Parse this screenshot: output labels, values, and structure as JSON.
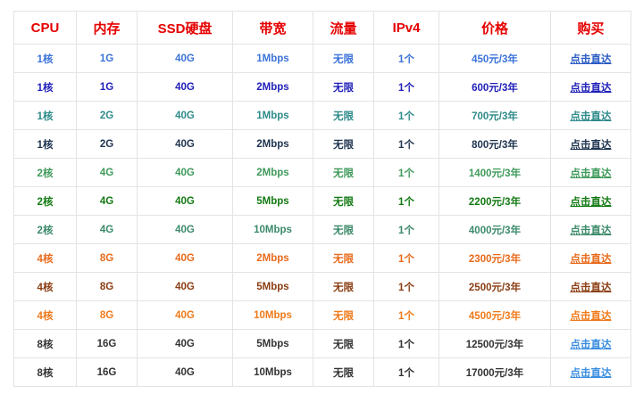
{
  "table": {
    "headers": [
      "CPU",
      "内存",
      "SSD硬盘",
      "带宽",
      "流量",
      "IPv4",
      "价格",
      "购买"
    ],
    "rows": [
      {
        "cpu": "1核",
        "memory": "1G",
        "ssd": "40G",
        "bandwidth": "1Mbps",
        "traffic": "无限",
        "ipv4": "1个",
        "price": "450元/3年",
        "buy_label": "点击直达",
        "color": "#3b73d9",
        "link_color": "#2a5bc4"
      },
      {
        "cpu": "1核",
        "memory": "1G",
        "ssd": "40G",
        "bandwidth": "2Mbps",
        "traffic": "无限",
        "ipv4": "1个",
        "price": "600元/3年",
        "buy_label": "点击直达",
        "color": "#1f1fb8",
        "link_color": "#1f1fb8"
      },
      {
        "cpu": "1核",
        "memory": "2G",
        "ssd": "40G",
        "bandwidth": "1Mbps",
        "traffic": "无限",
        "ipv4": "1个",
        "price": "700元/3年",
        "buy_label": "点击直达",
        "color": "#2e8a8a",
        "link_color": "#2e8a8a"
      },
      {
        "cpu": "1核",
        "memory": "2G",
        "ssd": "40G",
        "bandwidth": "2Mbps",
        "traffic": "无限",
        "ipv4": "1个",
        "price": "800元/3年",
        "buy_label": "点击直达",
        "color": "#1e3350",
        "link_color": "#1e3350"
      },
      {
        "cpu": "2核",
        "memory": "4G",
        "ssd": "40G",
        "bandwidth": "2Mbps",
        "traffic": "无限",
        "ipv4": "1个",
        "price": "1400元/3年",
        "buy_label": "点击直达",
        "color": "#3f9a5a",
        "link_color": "#3f9a5a"
      },
      {
        "cpu": "2核",
        "memory": "4G",
        "ssd": "40G",
        "bandwidth": "5Mbps",
        "traffic": "无限",
        "ipv4": "1个",
        "price": "2200元/3年",
        "buy_label": "点击直达",
        "color": "#137a13",
        "link_color": "#137a13"
      },
      {
        "cpu": "2核",
        "memory": "4G",
        "ssd": "40G",
        "bandwidth": "10Mbps",
        "traffic": "无限",
        "ipv4": "1个",
        "price": "4000元/3年",
        "buy_label": "点击直达",
        "color": "#3c8a6a",
        "link_color": "#3c8a6a"
      },
      {
        "cpu": "4核",
        "memory": "8G",
        "ssd": "40G",
        "bandwidth": "2Mbps",
        "traffic": "无限",
        "ipv4": "1个",
        "price": "2300元/3年",
        "buy_label": "点击直达",
        "color": "#e86a1a",
        "link_color": "#e86a1a"
      },
      {
        "cpu": "4核",
        "memory": "8G",
        "ssd": "40G",
        "bandwidth": "5Mbps",
        "traffic": "无限",
        "ipv4": "1个",
        "price": "2500元/3年",
        "buy_label": "点击直达",
        "color": "#8a3d12",
        "link_color": "#8a3d12"
      },
      {
        "cpu": "4核",
        "memory": "8G",
        "ssd": "40G",
        "bandwidth": "10Mbps",
        "traffic": "无限",
        "ipv4": "1个",
        "price": "4500元/3年",
        "buy_label": "点击直达",
        "color": "#f07a1a",
        "link_color": "#f07a1a"
      },
      {
        "cpu": "8核",
        "memory": "16G",
        "ssd": "40G",
        "bandwidth": "5Mbps",
        "traffic": "无限",
        "ipv4": "1个",
        "price": "12500元/3年",
        "buy_label": "点击直达",
        "color": "#333333",
        "link_color": "#3a8ee0"
      },
      {
        "cpu": "8核",
        "memory": "16G",
        "ssd": "40G",
        "bandwidth": "10Mbps",
        "traffic": "无限",
        "ipv4": "1个",
        "price": "17000元/3年",
        "buy_label": "点击直达",
        "color": "#333333",
        "link_color": "#3a8ee0"
      }
    ]
  },
  "colors": {
    "header_text": "#e50000",
    "border": "#e3e3e3"
  }
}
